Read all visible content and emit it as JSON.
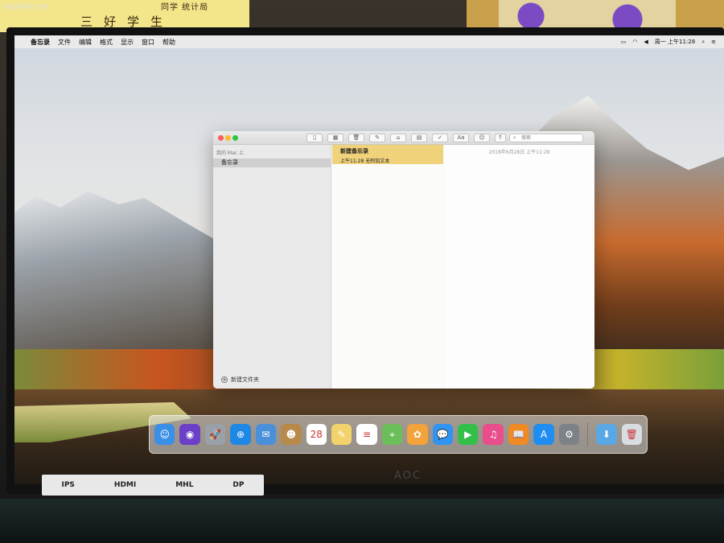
{
  "room": {
    "sign_text": "三好学生",
    "sign_small": "同学 统计局",
    "watermark": "老板那苹果工作室"
  },
  "menubar": {
    "items": [
      "备忘录",
      "文件",
      "编辑",
      "格式",
      "显示",
      "窗口",
      "帮助"
    ],
    "status_clock": "周一 上午11:28"
  },
  "notes_window": {
    "search_placeholder": "搜索",
    "sidebar": {
      "header": "我的 Mac 上",
      "folder": "备忘录",
      "new_folder": "新建文件夹"
    },
    "note": {
      "title": "新建备忘录",
      "meta": "上午11:28  无附加文本"
    },
    "editor_date": "2018年6月28日 上午11:28"
  },
  "dock": {
    "apps": [
      {
        "name": "Finder",
        "glyph": "☺",
        "color": "#3a8fe6"
      },
      {
        "name": "Siri",
        "glyph": "◉",
        "color": "#6b3fc8"
      },
      {
        "name": "Launchpad",
        "glyph": "🚀",
        "color": "#9aa0a8"
      },
      {
        "name": "Safari",
        "glyph": "⊕",
        "color": "#1e88e5"
      },
      {
        "name": "Mail",
        "glyph": "✉",
        "color": "#4a90d9"
      },
      {
        "name": "Contacts",
        "glyph": "☻",
        "color": "#b88a4a"
      },
      {
        "name": "Calendar",
        "glyph": "28",
        "color": "#ffffff"
      },
      {
        "name": "Notes",
        "glyph": "✎",
        "color": "#f2d26a"
      },
      {
        "name": "Reminders",
        "glyph": "≡",
        "color": "#ffffff"
      },
      {
        "name": "Maps",
        "glyph": "⌖",
        "color": "#6bbf59"
      },
      {
        "name": "Photos",
        "glyph": "✿",
        "color": "#f4a23a"
      },
      {
        "name": "Messages",
        "glyph": "💬",
        "color": "#2f95f0"
      },
      {
        "name": "FaceTime",
        "glyph": "▶",
        "color": "#33c04a"
      },
      {
        "name": "iTunes",
        "glyph": "♫",
        "color": "#e94d8c"
      },
      {
        "name": "iBooks",
        "glyph": "📖",
        "color": "#f08a24"
      },
      {
        "name": "App Store",
        "glyph": "A",
        "color": "#1f8ef0"
      },
      {
        "name": "System Preferences",
        "glyph": "⚙",
        "color": "#7d8288"
      },
      {
        "name": "Downloads",
        "glyph": "⬇",
        "color": "#5aa7e6"
      },
      {
        "name": "Trash",
        "glyph": "🗑",
        "color": "#d8dde2"
      }
    ]
  },
  "monitor": {
    "bezel_logos": [
      "IPS",
      "HDMI",
      "MHL",
      "DP"
    ],
    "brand": "AOC"
  }
}
